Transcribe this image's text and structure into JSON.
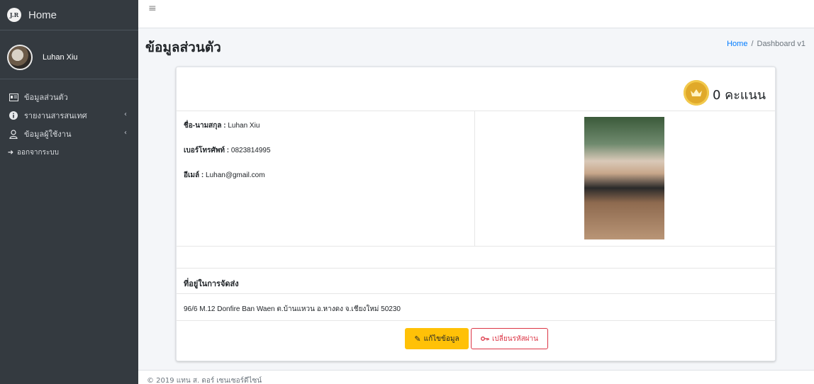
{
  "brand": {
    "logo": "J.R",
    "title": "Home"
  },
  "user": {
    "name": "Luhan Xiu"
  },
  "sidebar": {
    "items": [
      {
        "label": "ข้อมูลส่วนตัว",
        "icon": "id-card-icon"
      },
      {
        "label": "รายงานสารสนเทศ",
        "icon": "info-circle-icon",
        "has_submenu": true
      },
      {
        "label": "ข้อมูลผู้ใช้งาน",
        "icon": "user-icon",
        "has_submenu": true
      },
      {
        "label": "ออกจากระบบ",
        "icon": "sign-out-icon"
      }
    ]
  },
  "header": {
    "page_title": "ข้อมูลส่วนตัว",
    "breadcrumb": {
      "home": "Home",
      "sep": "/",
      "current": "Dashboard v1"
    }
  },
  "profile": {
    "points": "0 คะแนน",
    "name_label": "ชื่อ-นามสกุล : ",
    "name_value": "Luhan Xiu",
    "phone_label": "เบอร์โทรศัพท์ : ",
    "phone_value": "0823814995",
    "email_label": "อีเมล์ : ",
    "email_value": "Luhan@gmail.com",
    "address_heading": "ที่อยู่ในการจัดส่ง",
    "address_value": "96/6 M.12 Donfire Ban Waen ต.บ้านแหวน อ.หางดง จ.เชียงใหม่ 50230"
  },
  "actions": {
    "edit_label": "แก้ไขข้อมูล",
    "change_password_label": "เปลี่ยนรหัสผ่าน"
  },
  "footer": {
    "text": "© 2019 แทน ส. ดอร์ เซนเซอร์ดีไซน์"
  },
  "colors": {
    "sidebar_bg": "#343a40",
    "content_bg": "#f4f6f9",
    "primary_link": "#007bff",
    "warning": "#ffc107",
    "danger": "#dc3545",
    "coin": "#e0a92a"
  }
}
